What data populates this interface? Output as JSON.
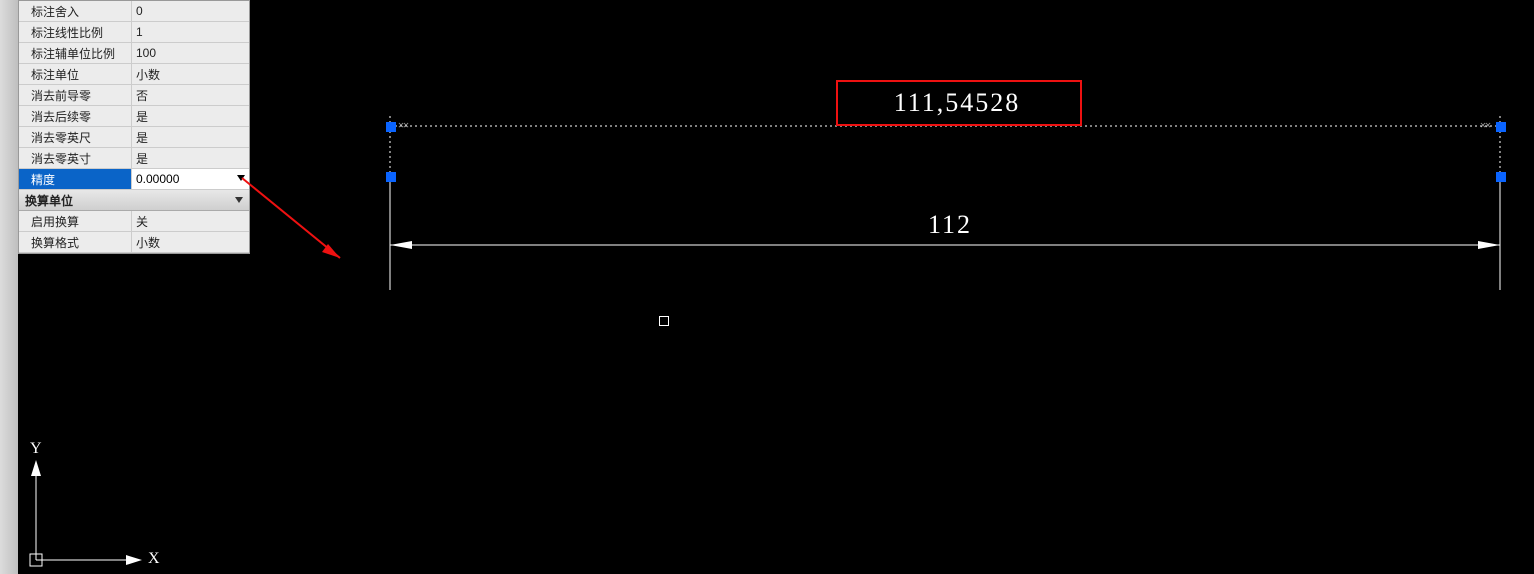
{
  "panel": {
    "rows": [
      {
        "label": "标注舍入",
        "value": "0"
      },
      {
        "label": "标注线性比例",
        "value": "1"
      },
      {
        "label": "标注辅单位比例",
        "value": "100"
      },
      {
        "label": "标注单位",
        "value": "小数"
      },
      {
        "label": "消去前导零",
        "value": "否"
      },
      {
        "label": "消去后续零",
        "value": "是"
      },
      {
        "label": "消去零英尺",
        "value": "是"
      },
      {
        "label": "消去零英寸",
        "value": "是"
      }
    ],
    "selected": {
      "label": "精度",
      "value": "0.00000"
    },
    "section": "换算单位",
    "rows2": [
      {
        "label": "启用换算",
        "value": "关"
      },
      {
        "label": "换算格式",
        "value": "小数"
      }
    ]
  },
  "drawing": {
    "dim1_text": "111,54528",
    "dim2_text": "112",
    "axis_y": "Y",
    "axis_x": "X"
  }
}
